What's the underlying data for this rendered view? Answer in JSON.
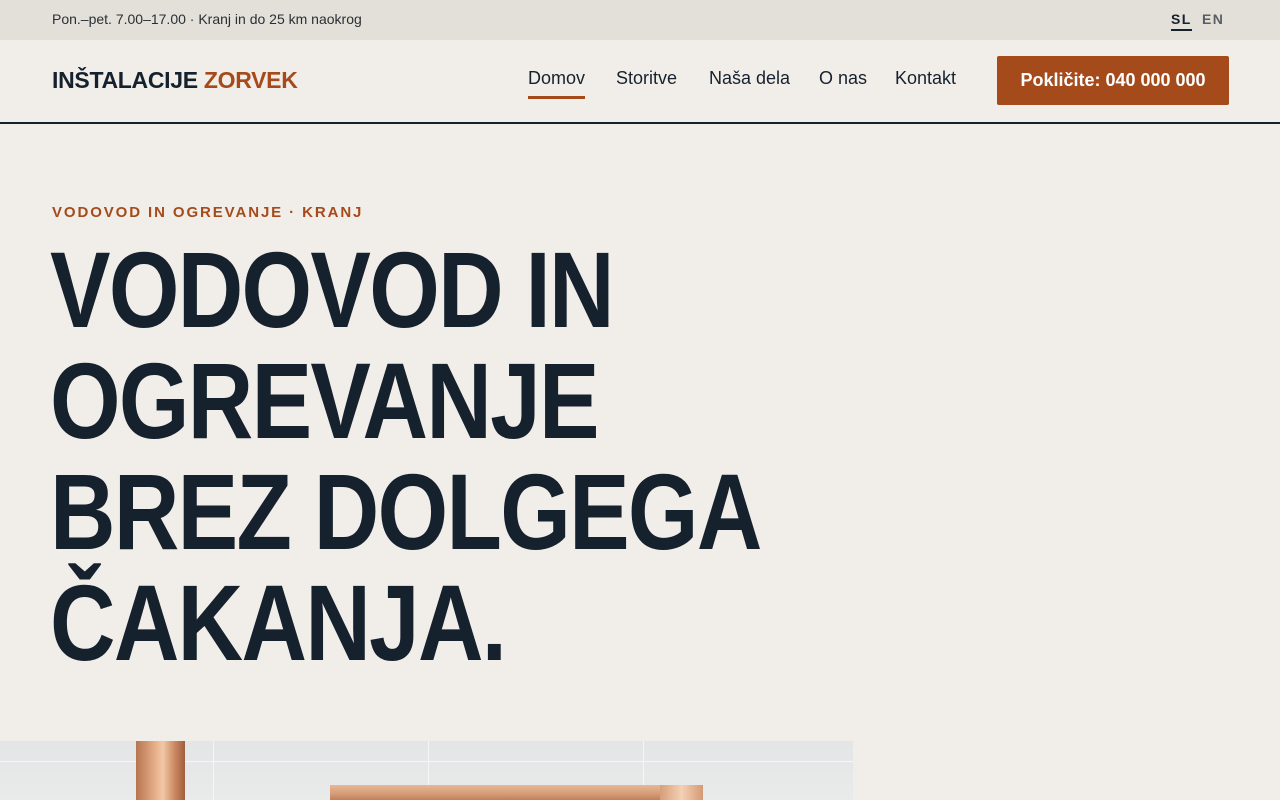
{
  "topbar": {
    "info": "Pon.–pet. 7.00–17.00 · Kranj in do 25 km naokrog",
    "languages": [
      {
        "code": "SL",
        "active": true
      },
      {
        "code": "EN",
        "active": false
      }
    ]
  },
  "header": {
    "logo_main": "INŠTALACIJE",
    "logo_accent": "ZORVEK",
    "nav": [
      {
        "label": "Domov",
        "active": true
      },
      {
        "label": "Storitve",
        "active": false
      },
      {
        "label": "Naša dela",
        "active": false
      },
      {
        "label": "O nas",
        "active": false
      },
      {
        "label": "Kontakt",
        "active": false
      }
    ],
    "cta_label": "Pokličite: 040 000 000"
  },
  "hero": {
    "eyebrow": "VODOVOD IN OGREVANJE · KRANJ",
    "title_lines": [
      "VODOVOD IN",
      "OGREVANJE",
      "BREZ DOLGEGA",
      "ČAKANJA."
    ]
  },
  "colors": {
    "background": "#f1eee9",
    "topbar": "#e3e0d9",
    "ink": "#16212e",
    "accent": "#a54a1b"
  }
}
